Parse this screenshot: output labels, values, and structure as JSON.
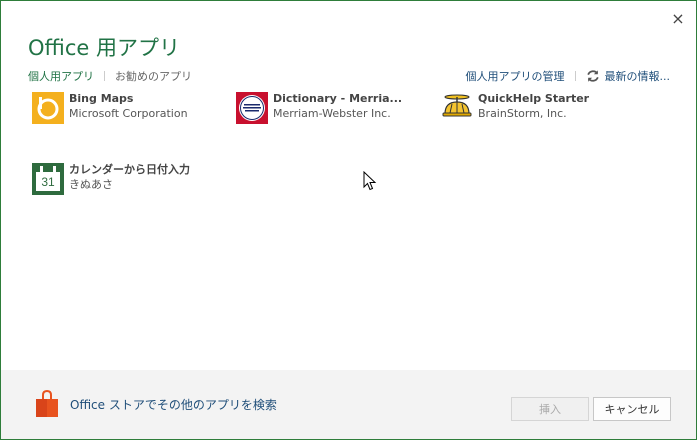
{
  "dialog": {
    "title": "Office 用アプリ",
    "close_glyph": "×"
  },
  "tabs": [
    {
      "label": "個人用アプリ",
      "active": true
    },
    {
      "label": "お勧めのアプリ",
      "active": false
    }
  ],
  "toplinks": {
    "manage": "個人用アプリの管理",
    "refresh": "最新の情報..."
  },
  "apps": [
    {
      "name": "Bing Maps",
      "publisher": "Microsoft Corporation",
      "icon": "bing-maps-icon"
    },
    {
      "name": "Dictionary - Merria...",
      "publisher": "Merriam-Webster Inc.",
      "icon": "merriam-webster-icon"
    },
    {
      "name": "QuickHelp Starter",
      "publisher": "BrainStorm, Inc.",
      "icon": "propeller-hat-icon"
    },
    {
      "name": "カレンダーから日付入力",
      "publisher": "きぬあさ",
      "icon": "calendar-icon",
      "icon_text": "31"
    }
  ],
  "footer": {
    "store_link": "Office ストアでその他のアプリを検索",
    "insert_button": "挿入",
    "cancel_button": "キャンセル"
  },
  "colors": {
    "accent": "#217346",
    "link": "#1f4e79",
    "bing": "#f4b01e",
    "mw_red": "#c8102e",
    "store_orange": "#e8531f"
  }
}
